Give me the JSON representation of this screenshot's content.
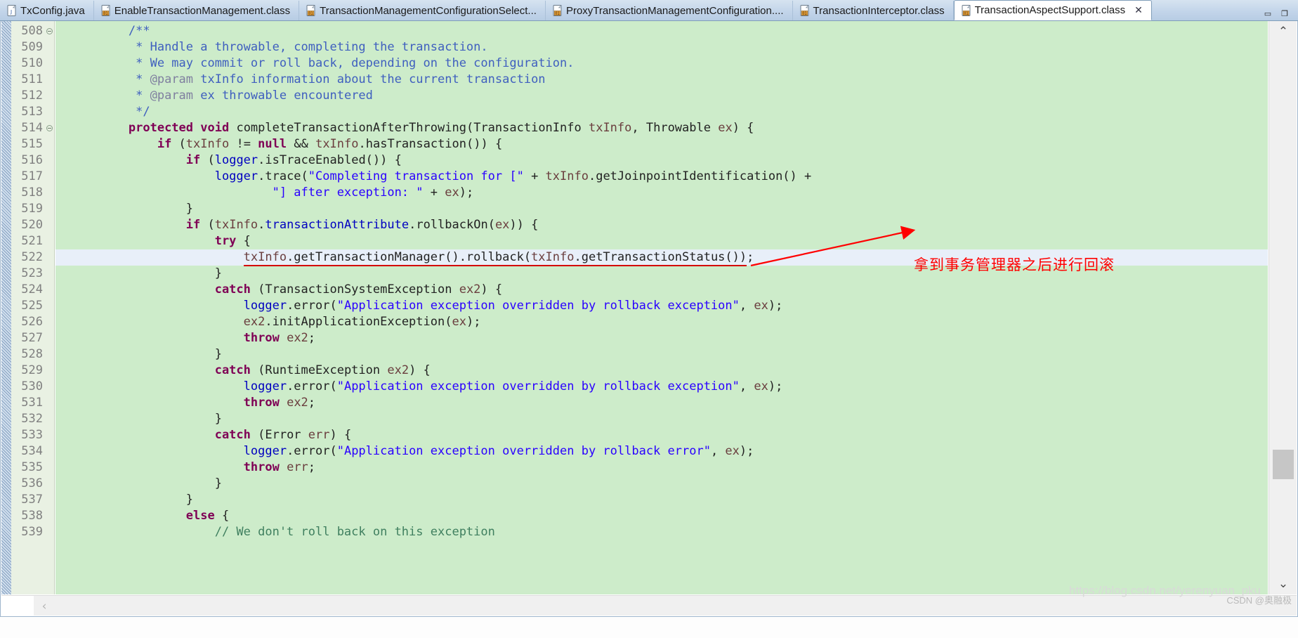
{
  "window": {
    "minimize_label": "▭",
    "maximize_label": "❐"
  },
  "tabs": [
    {
      "label": "TxConfig.java",
      "icon": "java-file-icon",
      "active": false,
      "closable": false
    },
    {
      "label": "EnableTransactionManagement.class",
      "icon": "class-file-icon",
      "active": false,
      "closable": false
    },
    {
      "label": "TransactionManagementConfigurationSelect...",
      "icon": "class-file-icon",
      "active": false,
      "closable": false
    },
    {
      "label": "ProxyTransactionManagementConfiguration....",
      "icon": "class-file-icon",
      "active": false,
      "closable": false
    },
    {
      "label": "TransactionInterceptor.class",
      "icon": "class-file-icon",
      "active": false,
      "closable": false
    },
    {
      "label": "TransactionAspectSupport.class",
      "icon": "class-file-icon",
      "active": true,
      "closable": true,
      "close_label": "✕"
    }
  ],
  "editor": {
    "first_line": 508,
    "highlighted_line": 522,
    "fold_lines": [
      508,
      514
    ],
    "lines": [
      {
        "n": 508,
        "tokens": [
          {
            "t": "        ",
            "c": ""
          },
          {
            "t": "/**",
            "c": "cmt"
          }
        ]
      },
      {
        "n": 509,
        "tokens": [
          {
            "t": "         ",
            "c": ""
          },
          {
            "t": "* Handle a throwable, completing the transaction.",
            "c": "cmt"
          }
        ]
      },
      {
        "n": 510,
        "tokens": [
          {
            "t": "         ",
            "c": ""
          },
          {
            "t": "* We may commit or roll back, depending on the configuration.",
            "c": "cmt"
          }
        ]
      },
      {
        "n": 511,
        "tokens": [
          {
            "t": "         ",
            "c": ""
          },
          {
            "t": "* ",
            "c": "cmt"
          },
          {
            "t": "@param",
            "c": "tag"
          },
          {
            "t": " txInfo information about the current transaction",
            "c": "cmt"
          }
        ]
      },
      {
        "n": 512,
        "tokens": [
          {
            "t": "         ",
            "c": ""
          },
          {
            "t": "* ",
            "c": "cmt"
          },
          {
            "t": "@param",
            "c": "tag"
          },
          {
            "t": " ex throwable encountered",
            "c": "cmt"
          }
        ]
      },
      {
        "n": 513,
        "tokens": [
          {
            "t": "         ",
            "c": ""
          },
          {
            "t": "*/",
            "c": "cmt"
          }
        ]
      },
      {
        "n": 514,
        "tokens": [
          {
            "t": "        ",
            "c": ""
          },
          {
            "t": "protected",
            "c": "kw"
          },
          {
            "t": " ",
            "c": ""
          },
          {
            "t": "void",
            "c": "kw"
          },
          {
            "t": " completeTransactionAfterThrowing(TransactionInfo ",
            "c": ""
          },
          {
            "t": "txInfo",
            "c": "par"
          },
          {
            "t": ", Throwable ",
            "c": ""
          },
          {
            "t": "ex",
            "c": "par"
          },
          {
            "t": ") {",
            "c": ""
          }
        ]
      },
      {
        "n": 515,
        "tokens": [
          {
            "t": "            ",
            "c": ""
          },
          {
            "t": "if",
            "c": "kw"
          },
          {
            "t": " (",
            "c": ""
          },
          {
            "t": "txInfo",
            "c": "par"
          },
          {
            "t": " != ",
            "c": ""
          },
          {
            "t": "null",
            "c": "kw"
          },
          {
            "t": " && ",
            "c": ""
          },
          {
            "t": "txInfo",
            "c": "par"
          },
          {
            "t": ".hasTransaction()) {",
            "c": ""
          }
        ]
      },
      {
        "n": 516,
        "tokens": [
          {
            "t": "                ",
            "c": ""
          },
          {
            "t": "if",
            "c": "kw"
          },
          {
            "t": " (",
            "c": ""
          },
          {
            "t": "logger",
            "c": "fld"
          },
          {
            "t": ".isTraceEnabled()) {",
            "c": ""
          }
        ]
      },
      {
        "n": 517,
        "tokens": [
          {
            "t": "                    ",
            "c": ""
          },
          {
            "t": "logger",
            "c": "fld"
          },
          {
            "t": ".trace(",
            "c": ""
          },
          {
            "t": "\"Completing transaction for [\"",
            "c": "str"
          },
          {
            "t": " + ",
            "c": ""
          },
          {
            "t": "txInfo",
            "c": "par"
          },
          {
            "t": ".getJoinpointIdentification() +",
            "c": ""
          }
        ]
      },
      {
        "n": 518,
        "tokens": [
          {
            "t": "                            ",
            "c": ""
          },
          {
            "t": "\"] after exception: \"",
            "c": "str"
          },
          {
            "t": " + ",
            "c": ""
          },
          {
            "t": "ex",
            "c": "par"
          },
          {
            "t": ");",
            "c": ""
          }
        ]
      },
      {
        "n": 519,
        "tokens": [
          {
            "t": "                }",
            "c": ""
          }
        ]
      },
      {
        "n": 520,
        "tokens": [
          {
            "t": "                ",
            "c": ""
          },
          {
            "t": "if",
            "c": "kw"
          },
          {
            "t": " (",
            "c": ""
          },
          {
            "t": "txInfo",
            "c": "par"
          },
          {
            "t": ".",
            "c": ""
          },
          {
            "t": "transactionAttribute",
            "c": "fld"
          },
          {
            "t": ".rollbackOn(",
            "c": ""
          },
          {
            "t": "ex",
            "c": "par"
          },
          {
            "t": ")) {",
            "c": ""
          }
        ]
      },
      {
        "n": 521,
        "tokens": [
          {
            "t": "                    ",
            "c": ""
          },
          {
            "t": "try",
            "c": "kw"
          },
          {
            "t": " {",
            "c": ""
          }
        ]
      },
      {
        "n": 522,
        "tokens": [
          {
            "t": "                        ",
            "c": ""
          },
          {
            "t": "txInfo",
            "c": "par",
            "u": true
          },
          {
            "t": ".getTransactionManager().rollback(",
            "c": "",
            "u": true
          },
          {
            "t": "txInfo",
            "c": "par",
            "u": true
          },
          {
            "t": ".getTransactionStatus())",
            "c": "",
            "u": true
          },
          {
            "t": ";",
            "c": ""
          }
        ]
      },
      {
        "n": 523,
        "tokens": [
          {
            "t": "                    }",
            "c": ""
          }
        ]
      },
      {
        "n": 524,
        "tokens": [
          {
            "t": "                    ",
            "c": ""
          },
          {
            "t": "catch",
            "c": "kw"
          },
          {
            "t": " (TransactionSystemException ",
            "c": ""
          },
          {
            "t": "ex2",
            "c": "par"
          },
          {
            "t": ") {",
            "c": ""
          }
        ]
      },
      {
        "n": 525,
        "tokens": [
          {
            "t": "                        ",
            "c": ""
          },
          {
            "t": "logger",
            "c": "fld"
          },
          {
            "t": ".error(",
            "c": ""
          },
          {
            "t": "\"Application exception overridden by rollback exception\"",
            "c": "str"
          },
          {
            "t": ", ",
            "c": ""
          },
          {
            "t": "ex",
            "c": "par"
          },
          {
            "t": ");",
            "c": ""
          }
        ]
      },
      {
        "n": 526,
        "tokens": [
          {
            "t": "                        ",
            "c": ""
          },
          {
            "t": "ex2",
            "c": "par"
          },
          {
            "t": ".initApplicationException(",
            "c": ""
          },
          {
            "t": "ex",
            "c": "par"
          },
          {
            "t": ");",
            "c": ""
          }
        ]
      },
      {
        "n": 527,
        "tokens": [
          {
            "t": "                        ",
            "c": ""
          },
          {
            "t": "throw",
            "c": "kw"
          },
          {
            "t": " ",
            "c": ""
          },
          {
            "t": "ex2",
            "c": "par"
          },
          {
            "t": ";",
            "c": ""
          }
        ]
      },
      {
        "n": 528,
        "tokens": [
          {
            "t": "                    }",
            "c": ""
          }
        ]
      },
      {
        "n": 529,
        "tokens": [
          {
            "t": "                    ",
            "c": ""
          },
          {
            "t": "catch",
            "c": "kw"
          },
          {
            "t": " (RuntimeException ",
            "c": ""
          },
          {
            "t": "ex2",
            "c": "par"
          },
          {
            "t": ") {",
            "c": ""
          }
        ]
      },
      {
        "n": 530,
        "tokens": [
          {
            "t": "                        ",
            "c": ""
          },
          {
            "t": "logger",
            "c": "fld"
          },
          {
            "t": ".error(",
            "c": ""
          },
          {
            "t": "\"Application exception overridden by rollback exception\"",
            "c": "str"
          },
          {
            "t": ", ",
            "c": ""
          },
          {
            "t": "ex",
            "c": "par"
          },
          {
            "t": ");",
            "c": ""
          }
        ]
      },
      {
        "n": 531,
        "tokens": [
          {
            "t": "                        ",
            "c": ""
          },
          {
            "t": "throw",
            "c": "kw"
          },
          {
            "t": " ",
            "c": ""
          },
          {
            "t": "ex2",
            "c": "par"
          },
          {
            "t": ";",
            "c": ""
          }
        ]
      },
      {
        "n": 532,
        "tokens": [
          {
            "t": "                    }",
            "c": ""
          }
        ]
      },
      {
        "n": 533,
        "tokens": [
          {
            "t": "                    ",
            "c": ""
          },
          {
            "t": "catch",
            "c": "kw"
          },
          {
            "t": " (Error ",
            "c": ""
          },
          {
            "t": "err",
            "c": "par"
          },
          {
            "t": ") {",
            "c": ""
          }
        ]
      },
      {
        "n": 534,
        "tokens": [
          {
            "t": "                        ",
            "c": ""
          },
          {
            "t": "logger",
            "c": "fld"
          },
          {
            "t": ".error(",
            "c": ""
          },
          {
            "t": "\"Application exception overridden by rollback error\"",
            "c": "str"
          },
          {
            "t": ", ",
            "c": ""
          },
          {
            "t": "ex",
            "c": "par"
          },
          {
            "t": ");",
            "c": ""
          }
        ]
      },
      {
        "n": 535,
        "tokens": [
          {
            "t": "                        ",
            "c": ""
          },
          {
            "t": "throw",
            "c": "kw"
          },
          {
            "t": " ",
            "c": ""
          },
          {
            "t": "err",
            "c": "par"
          },
          {
            "t": ";",
            "c": ""
          }
        ]
      },
      {
        "n": 536,
        "tokens": [
          {
            "t": "                    }",
            "c": ""
          }
        ]
      },
      {
        "n": 537,
        "tokens": [
          {
            "t": "                }",
            "c": ""
          }
        ]
      },
      {
        "n": 538,
        "tokens": [
          {
            "t": "                ",
            "c": ""
          },
          {
            "t": "else",
            "c": "kw"
          },
          {
            "t": " {",
            "c": ""
          }
        ]
      },
      {
        "n": 539,
        "tokens": [
          {
            "t": "                    ",
            "c": ""
          },
          {
            "t": "// We don't roll back on this exception",
            "c": "lcmt"
          }
        ]
      }
    ]
  },
  "annotation": {
    "text": "拿到事务管理器之后进行回滚",
    "color": "#ff0000"
  },
  "scrollbars": {
    "vertical_up": "⌃",
    "vertical_down": "⌄",
    "horizontal_left": "‹"
  },
  "watermark": {
    "url": "https://blog.csdn.net/yerenyuan_pku",
    "label": "CSDN @奥融极"
  }
}
